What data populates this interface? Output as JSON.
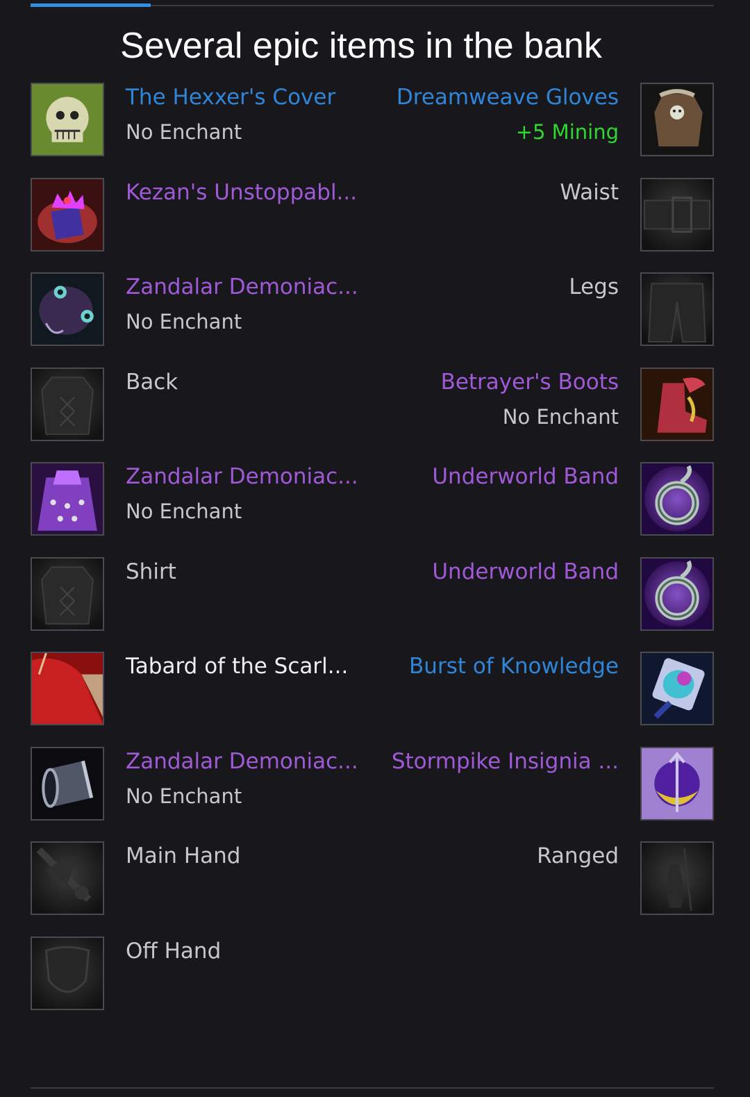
{
  "page": {
    "title": "Several epic items in the bank"
  },
  "colors": {
    "epic": "#a05ad8",
    "rare": "#2f86d8",
    "common": "#f0f0f0",
    "empty_slot": "#c8c8c8",
    "enchant_bonus": "#2ed82e",
    "tab_active": "#2f8fe0"
  },
  "left_slots": [
    {
      "name": "The Hexxer's Cover",
      "quality": "rare",
      "sub": "No Enchant",
      "icon": "skull-helm-icon"
    },
    {
      "name": "Kezan's Unstoppabl...",
      "quality": "epic",
      "sub": "",
      "icon": "crown-necklace-icon"
    },
    {
      "name": "Zandalar Demoniac...",
      "quality": "epic",
      "sub": "No Enchant",
      "icon": "spider-shoulder-icon"
    },
    {
      "name": "Back",
      "quality": "empty",
      "sub": "",
      "icon": "empty-back-slot-icon"
    },
    {
      "name": "Zandalar Demoniac...",
      "quality": "epic",
      "sub": "No Enchant",
      "icon": "purple-robe-icon"
    },
    {
      "name": "Shirt",
      "quality": "empty",
      "sub": "",
      "icon": "empty-shirt-slot-icon"
    },
    {
      "name": "Tabard of the Scarl...",
      "quality": "common",
      "sub": "",
      "icon": "red-tabard-icon"
    },
    {
      "name": "Zandalar Demoniac...",
      "quality": "epic",
      "sub": "No Enchant",
      "icon": "bracer-icon"
    },
    {
      "name": "Main Hand",
      "quality": "empty",
      "sub": "",
      "icon": "empty-main-hand-slot-icon"
    },
    {
      "name": "Off Hand",
      "quality": "empty",
      "sub": "",
      "icon": "empty-off-hand-slot-icon"
    }
  ],
  "right_slots": [
    {
      "name": "Dreamweave Gloves",
      "quality": "rare",
      "sub": "+5 Mining",
      "sub_green": true,
      "icon": "gloves-icon"
    },
    {
      "name": "Waist",
      "quality": "empty",
      "sub": "",
      "icon": "empty-waist-slot-icon"
    },
    {
      "name": "Legs",
      "quality": "empty",
      "sub": "",
      "icon": "empty-legs-slot-icon"
    },
    {
      "name": "Betrayer's Boots",
      "quality": "epic",
      "sub": "No Enchant",
      "icon": "boots-icon"
    },
    {
      "name": "Underworld Band",
      "quality": "epic",
      "sub": "",
      "icon": "ring-icon"
    },
    {
      "name": "Underworld Band",
      "quality": "epic",
      "sub": "",
      "icon": "ring-icon"
    },
    {
      "name": "Burst of Knowledge",
      "quality": "rare",
      "sub": "",
      "icon": "gem-trinket-icon"
    },
    {
      "name": "Stormpike Insignia ...",
      "quality": "epic",
      "sub": "",
      "icon": "insignia-trinket-icon"
    },
    {
      "name": "Ranged",
      "quality": "empty",
      "sub": "",
      "icon": "empty-ranged-slot-icon"
    }
  ]
}
